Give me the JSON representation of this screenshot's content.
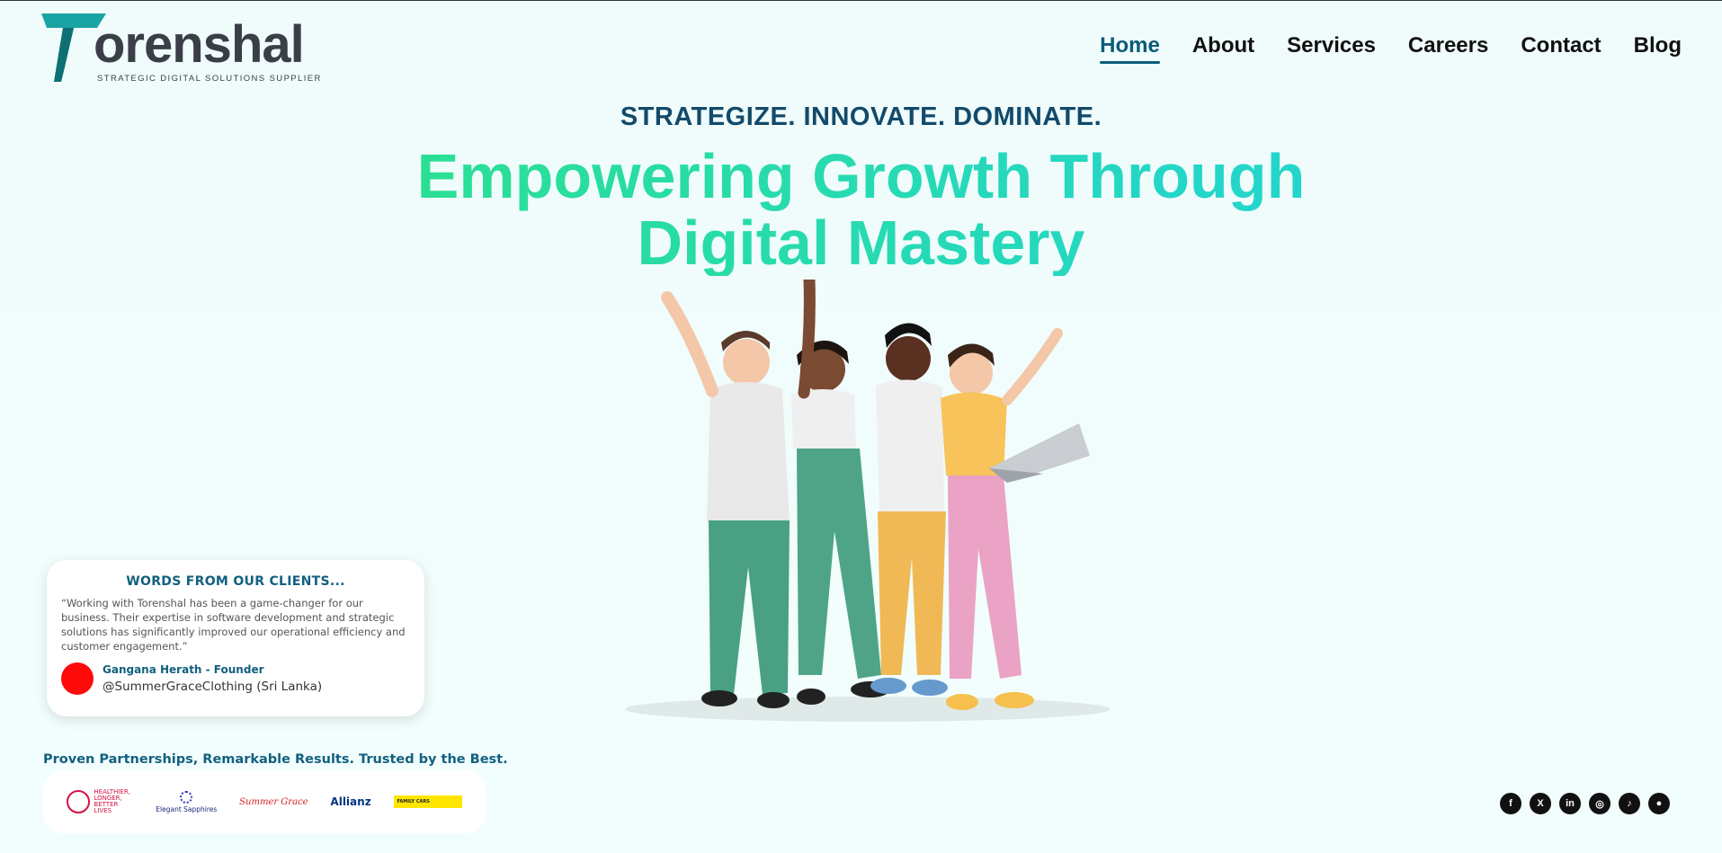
{
  "brand": {
    "name": "orenshal",
    "tagline": "STRATEGIC DIGITAL SOLUTIONS SUPPLIER",
    "accent": "#1aa3a3"
  },
  "nav": {
    "items": [
      {
        "label": "Home",
        "active": true
      },
      {
        "label": "About"
      },
      {
        "label": "Services"
      },
      {
        "label": "Careers"
      },
      {
        "label": "Contact"
      },
      {
        "label": "Blog"
      }
    ]
  },
  "hero": {
    "eyebrow": "STRATEGIZE. INNOVATE. DOMINATE.",
    "headline_line1": "Empowering Growth Through",
    "headline_line2": "Digital Mastery",
    "gradient_from": "#2be08f",
    "gradient_to": "#24d6c9"
  },
  "testimonial": {
    "title": "WORDS FROM OUR CLIENTS...",
    "quote": "“Working with Torenshal has been a game-changer for our business. Their expertise in software development and strategic solutions has significantly improved our operational efficiency and customer engagement.”",
    "author": "Gangana Herath - Founder",
    "handle": "@SummerGraceClothing (Sri Lanka)"
  },
  "partners": {
    "title": "Proven Partnerships, Remarkable Results. Trusted by the Best.",
    "logos": [
      {
        "name": "aia-logo",
        "text": "HEALTHIER, LONGER, BETTER LIVES"
      },
      {
        "name": "elegant-sapphires-logo",
        "text": "Elegant Sapphires"
      },
      {
        "name": "summer-grace-logo",
        "text": "Summer Grace"
      },
      {
        "name": "allianz-logo",
        "text": "Allianz"
      },
      {
        "name": "family-cars-logo",
        "text": "FAMILY CARS"
      }
    ]
  },
  "socials": [
    {
      "name": "facebook-icon",
      "glyph": "f"
    },
    {
      "name": "x-icon",
      "glyph": "X"
    },
    {
      "name": "linkedin-icon",
      "glyph": "in"
    },
    {
      "name": "instagram-icon",
      "glyph": "◎"
    },
    {
      "name": "tiktok-icon",
      "glyph": "♪"
    },
    {
      "name": "github-icon",
      "glyph": "●"
    }
  ]
}
